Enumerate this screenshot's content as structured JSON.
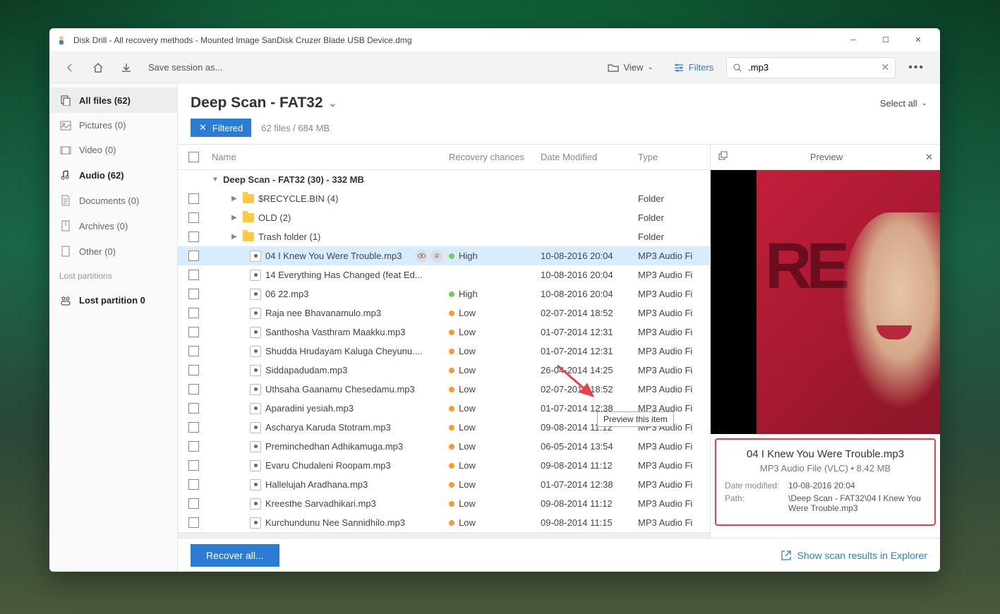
{
  "titlebar": {
    "title": "Disk Drill - All recovery methods - Mounted Image SanDisk Cruzer Blade USB Device.dmg"
  },
  "toolbar": {
    "save_label": "Save session as...",
    "view_label": "View",
    "filters_label": "Filters",
    "search_value": ".mp3"
  },
  "sidebar": {
    "items": [
      {
        "label": "All files (62)"
      },
      {
        "label": "Pictures (0)"
      },
      {
        "label": "Video (0)"
      },
      {
        "label": "Audio (62)"
      },
      {
        "label": "Documents (0)"
      },
      {
        "label": "Archives (0)"
      },
      {
        "label": "Other (0)"
      }
    ],
    "lost_header": "Lost partitions",
    "lost_partition": "Lost partition 0"
  },
  "main": {
    "title": "Deep Scan - FAT32",
    "select_all": "Select all",
    "filtered_badge": "Filtered",
    "filter_info": "62 files / 684 MB"
  },
  "columns": {
    "name": "Name",
    "recovery": "Recovery chances",
    "date": "Date Modified",
    "type": "Type"
  },
  "group": {
    "label": "Deep Scan - FAT32 (30) - 332 MB"
  },
  "folders": [
    {
      "name": "$RECYCLE.BIN (4)",
      "type": "Folder"
    },
    {
      "name": "OLD (2)",
      "type": "Folder"
    },
    {
      "name": "Trash folder (1)",
      "type": "Folder"
    }
  ],
  "files": [
    {
      "name": "04 I Knew You Were Trouble.mp3",
      "recovery": "High",
      "date": "10-08-2016 20:04",
      "type": "MP3 Audio Fi"
    },
    {
      "name": "14 Everything Has Changed (feat Ed...",
      "recovery": "",
      "date": "10-08-2016 20:04",
      "type": "MP3 Audio Fi"
    },
    {
      "name": "06 22.mp3",
      "recovery": "High",
      "date": "10-08-2016 20:04",
      "type": "MP3 Audio Fi"
    },
    {
      "name": "Raja nee Bhavanamulo.mp3",
      "recovery": "Low",
      "date": "02-07-2014 18:52",
      "type": "MP3 Audio Fi"
    },
    {
      "name": "Santhosha Vasthram Maakku.mp3",
      "recovery": "Low",
      "date": "01-07-2014 12:31",
      "type": "MP3 Audio Fi"
    },
    {
      "name": "Shudda Hrudayam Kaluga Cheyunu....",
      "recovery": "Low",
      "date": "01-07-2014 12:31",
      "type": "MP3 Audio Fi"
    },
    {
      "name": "Siddapadudam.mp3",
      "recovery": "Low",
      "date": "26-04-2014 14:25",
      "type": "MP3 Audio Fi"
    },
    {
      "name": "Uthsaha Gaanamu Chesedamu.mp3",
      "recovery": "Low",
      "date": "02-07-2014 18:52",
      "type": "MP3 Audio Fi"
    },
    {
      "name": "Aparadini yesiah.mp3",
      "recovery": "Low",
      "date": "01-07-2014 12:38",
      "type": "MP3 Audio Fi"
    },
    {
      "name": "Ascharya Karuda Stotram.mp3",
      "recovery": "Low",
      "date": "09-08-2014 11:12",
      "type": "MP3 Audio Fi"
    },
    {
      "name": "Preminchedhan Adhikamuga.mp3",
      "recovery": "Low",
      "date": "06-05-2014 13:54",
      "type": "MP3 Audio Fi"
    },
    {
      "name": "Evaru Chudaleni Roopam.mp3",
      "recovery": "Low",
      "date": "09-08-2014 11:12",
      "type": "MP3 Audio Fi"
    },
    {
      "name": "Hallelujah Aradhana.mp3",
      "recovery": "Low",
      "date": "01-07-2014 12:38",
      "type": "MP3 Audio Fi"
    },
    {
      "name": "Kreesthe Sarvadhikari.mp3",
      "recovery": "Low",
      "date": "09-08-2014 11:12",
      "type": "MP3 Audio Fi"
    },
    {
      "name": "Kurchundunu Nee Sannidhilo.mp3",
      "recovery": "Low",
      "date": "09-08-2014 11:15",
      "type": "MP3 Audio Fi"
    }
  ],
  "tooltip": "Preview this item",
  "preview": {
    "header": "Preview",
    "album_text": "RE",
    "name": "04 I Knew You Were Trouble.mp3",
    "meta": "MP3 Audio File (VLC) • 8.42 MB",
    "date_label": "Date modified:",
    "date_value": "10-08-2016 20:04",
    "path_label": "Path:",
    "path_value": "\\Deep Scan - FAT32\\04 I Knew You Were Trouble.mp3"
  },
  "footer": {
    "recover": "Recover all...",
    "explorer": "Show scan results in Explorer"
  }
}
